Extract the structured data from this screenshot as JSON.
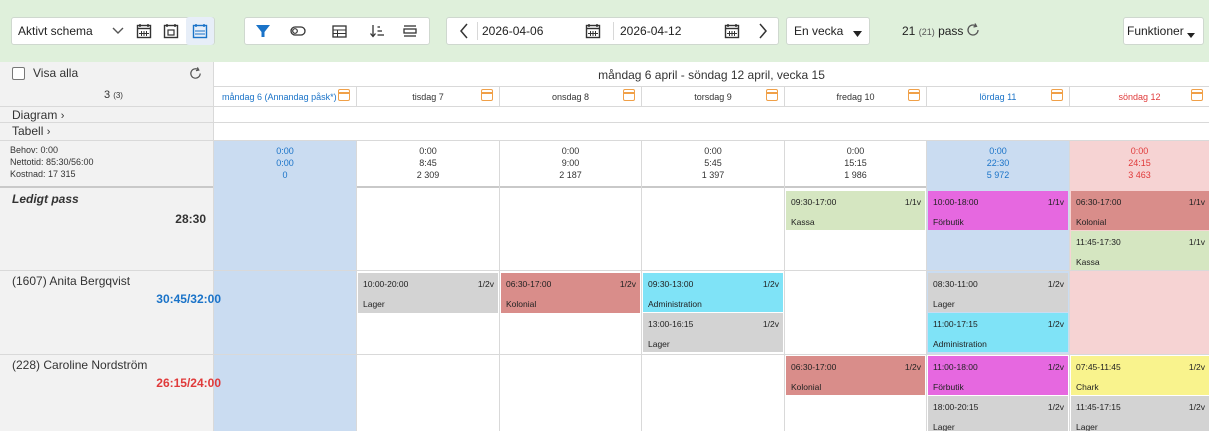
{
  "toolbar": {
    "schema_label": "Aktivt schema",
    "date_from": "2026-04-06",
    "date_to": "2026-04-12",
    "period_label": "En vecka",
    "pass_count": "21",
    "pass_total": "(21)",
    "pass_label": "pass",
    "functions_label": "Funktioner"
  },
  "sidebar": {
    "show_all": "Visa alla",
    "count": "3",
    "count_total": "(3)",
    "diagram": "Diagram",
    "table": "Tabell",
    "needs": "Behov: 0:00",
    "net_time": "Nettotid: 85:30/56:00",
    "cost": "Kostnad: 17 315"
  },
  "week_title": "måndag 6 april - söndag 12 april, vecka 15",
  "days": [
    {
      "label": "måndag 6 (Annandag påsk*)",
      "behov": "0:00",
      "hours": "0:00",
      "cost": "0"
    },
    {
      "label": "tisdag 7",
      "behov": "0:00",
      "hours": "8:45",
      "cost": "2 309"
    },
    {
      "label": "onsdag 8",
      "behov": "0:00",
      "hours": "9:00",
      "cost": "2 187"
    },
    {
      "label": "torsdag 9",
      "behov": "0:00",
      "hours": "5:45",
      "cost": "1 397"
    },
    {
      "label": "fredag 10",
      "behov": "0:00",
      "hours": "15:15",
      "cost": "1 986"
    },
    {
      "label": "lördag 11",
      "behov": "0:00",
      "hours": "22:30",
      "cost": "5 972"
    },
    {
      "label": "söndag 12",
      "behov": "0:00",
      "hours": "24:15",
      "cost": "3 463"
    }
  ],
  "rows": [
    {
      "name": "Ledigt pass",
      "value": "28:30"
    },
    {
      "name": "(1607) Anita Bergqvist",
      "value": "30:45/32:00"
    },
    {
      "name": "(228) Caroline Nordström",
      "value": "26:15/24:00"
    }
  ],
  "shifts": [
    {
      "time": "09:30-17:00",
      "ratio": "1/1v",
      "dept": "Kassa"
    },
    {
      "time": "10:00-18:00",
      "ratio": "1/1v",
      "dept": "Förbutik"
    },
    {
      "time": "06:30-17:00",
      "ratio": "1/1v",
      "dept": "Kolonial"
    },
    {
      "time": "11:45-17:30",
      "ratio": "1/1v",
      "dept": "Kassa"
    },
    {
      "time": "10:00-20:00",
      "ratio": "1/2v",
      "dept": "Lager"
    },
    {
      "time": "06:30-17:00",
      "ratio": "1/2v",
      "dept": "Kolonial"
    },
    {
      "time": "09:30-13:00",
      "ratio": "1/2v",
      "dept": "Administration"
    },
    {
      "time": "13:00-16:15",
      "ratio": "1/2v",
      "dept": "Lager"
    },
    {
      "time": "08:30-11:00",
      "ratio": "1/2v",
      "dept": "Lager"
    },
    {
      "time": "11:00-17:15",
      "ratio": "1/2v",
      "dept": "Administration"
    },
    {
      "time": "06:30-17:00",
      "ratio": "1/2v",
      "dept": "Kolonial"
    },
    {
      "time": "11:00-18:00",
      "ratio": "1/2v",
      "dept": "Förbutik"
    },
    {
      "time": "18:00-20:15",
      "ratio": "1/2v",
      "dept": "Lager"
    },
    {
      "time": "07:45-11:45",
      "ratio": "1/2v",
      "dept": "Chark"
    },
    {
      "time": "11:45-17:15",
      "ratio": "1/2v",
      "dept": "Lager"
    }
  ],
  "colors": {
    "toolbar_bg": "#dff0db",
    "accent_blue": "#1a73c8",
    "monday_bg": "#cadcf1",
    "saturday_bg": "#cadcf1",
    "sunday_bg": "#f6d3d3",
    "kassa": "#d5e6c1",
    "forbutik": "#e668e0",
    "kolonial": "#d98d8a",
    "lager": "#d3d3d3",
    "administration": "#7fe3f7",
    "chark": "#f9f38d",
    "over_red": "#e03a3a"
  }
}
